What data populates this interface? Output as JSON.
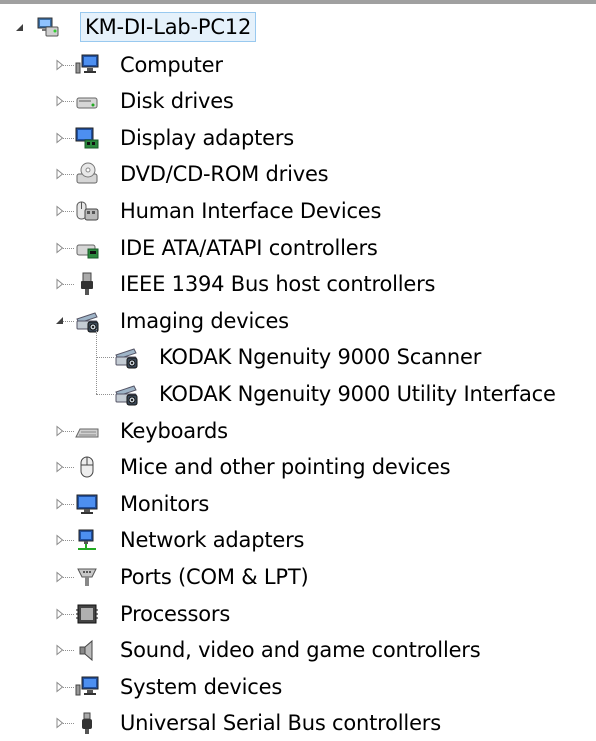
{
  "root": {
    "label": "KM-DI-Lab-PC12",
    "icon": "computer-network-icon",
    "expanded": true
  },
  "categories": [
    {
      "label": "Computer",
      "icon": "computer-icon",
      "expanded": false
    },
    {
      "label": "Disk drives",
      "icon": "disk-drive-icon",
      "expanded": false
    },
    {
      "label": "Display adapters",
      "icon": "display-adapter-icon",
      "expanded": false
    },
    {
      "label": "DVD/CD-ROM drives",
      "icon": "dvd-drive-icon",
      "expanded": false
    },
    {
      "label": "Human Interface Devices",
      "icon": "hid-icon",
      "expanded": false
    },
    {
      "label": "IDE ATA/ATAPI controllers",
      "icon": "ide-controller-icon",
      "expanded": false
    },
    {
      "label": "IEEE 1394 Bus host controllers",
      "icon": "firewire-icon",
      "expanded": false
    },
    {
      "label": "Imaging devices",
      "icon": "scanner-icon",
      "expanded": true,
      "children": [
        {
          "label": "KODAK Ngenuity 9000 Scanner",
          "icon": "scanner-icon"
        },
        {
          "label": "KODAK Ngenuity 9000 Utility Interface",
          "icon": "scanner-icon"
        }
      ]
    },
    {
      "label": "Keyboards",
      "icon": "keyboard-icon",
      "expanded": false
    },
    {
      "label": "Mice and other pointing devices",
      "icon": "mouse-icon",
      "expanded": false
    },
    {
      "label": "Monitors",
      "icon": "monitor-icon",
      "expanded": false
    },
    {
      "label": "Network adapters",
      "icon": "network-adapter-icon",
      "expanded": false
    },
    {
      "label": "Ports (COM & LPT)",
      "icon": "port-icon",
      "expanded": false
    },
    {
      "label": "Processors",
      "icon": "processor-icon",
      "expanded": false
    },
    {
      "label": "Sound, video and game controllers",
      "icon": "speaker-icon",
      "expanded": false
    },
    {
      "label": "System devices",
      "icon": "system-device-icon",
      "expanded": false
    },
    {
      "label": "Universal Serial Bus controllers",
      "icon": "usb-icon",
      "expanded": false
    }
  ],
  "colors": {
    "selection_bg": "#e5f1fb",
    "selection_border": "#99c9ef",
    "connector": "#909090"
  }
}
